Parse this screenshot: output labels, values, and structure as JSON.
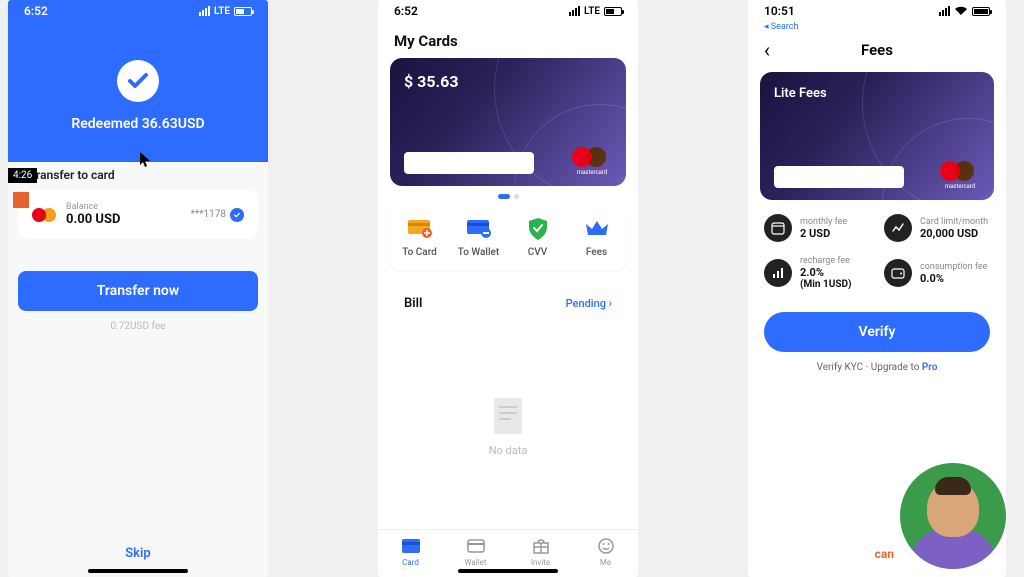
{
  "video": {
    "timestamp": "4:26"
  },
  "phone1": {
    "status_time": "6:52",
    "net": "LTE",
    "redeemed_label": "Redeemed 36.63USD",
    "transfer_heading": "ransfer to card",
    "balance_label": "Balance",
    "balance_value": "0.00 USD",
    "masked": "***1178",
    "button": "Transfer now",
    "fee_text": "0.72USD fee",
    "skip": "Skip"
  },
  "phone2": {
    "status_time": "6:52",
    "net": "LTE",
    "title": "My Cards",
    "card_balance": "$ 35.63",
    "card_brand": "mastercard",
    "actions": {
      "to_card": "To Card",
      "to_wallet": "To Wallet",
      "cvv": "CVV",
      "fees": "Fees"
    },
    "bill_label": "Bill",
    "bill_status": "Pending",
    "nodata": "No data",
    "tabs": {
      "card": "Card",
      "wallet": "Wallet",
      "invite": "Invite",
      "me": "Me"
    }
  },
  "phone3": {
    "status_time": "10:51",
    "search_label": "Search",
    "title": "Fees",
    "card_title": "Lite Fees",
    "card_brand": "mastercard",
    "fee_monthly_label": "monthly fee",
    "fee_monthly_value": "2 USD",
    "fee_limit_label": "Card limit/month",
    "fee_limit_value": "20,000 USD",
    "fee_recharge_label": "recharge fee",
    "fee_recharge_value": "2.0%",
    "fee_recharge_sub": "(Min 1USD)",
    "fee_consume_label": "consumption fee",
    "fee_consume_value": "0.0%",
    "verify_button": "Verify",
    "kyc_prefix": "Verify KYC · Upgrade to ",
    "kyc_pro": "Pro",
    "caption": "can"
  }
}
